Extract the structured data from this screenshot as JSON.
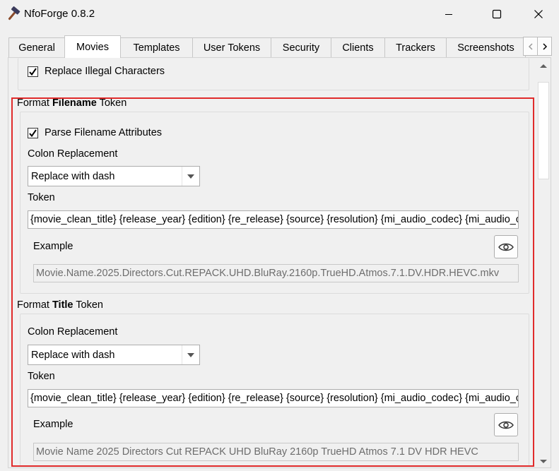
{
  "window": {
    "title": "NfoForge 0.8.2",
    "icons": {
      "app": "hammer-icon",
      "minimize": "minimize-icon",
      "maximize": "maximize-icon",
      "close": "close-icon"
    }
  },
  "tabs": [
    "General",
    "Movies",
    "Templates",
    "User Tokens",
    "Security",
    "Clients",
    "Trackers",
    "Screenshots"
  ],
  "active_tab": "Movies",
  "top_section": {
    "replace_illegal_label": "Replace Illegal Characters",
    "replace_illegal_checked": true
  },
  "filename_section": {
    "title_prefix": "Format ",
    "title_bold": "Filename",
    "title_suffix": " Token",
    "parse_label": "Parse Filename Attributes",
    "parse_checked": true,
    "colon_label": "Colon Replacement",
    "colon_value": "Replace with dash",
    "token_label": "Token",
    "token_value": "{movie_clean_title} {release_year} {edition} {re_release} {source} {resolution} {mi_audio_codec} {mi_audio_channel_s}",
    "example_label": "Example",
    "example_value": "Movie.Name.2025.Directors.Cut.REPACK.UHD.BluRay.2160p.TrueHD.Atmos.7.1.DV.HDR.HEVC.mkv"
  },
  "title_section": {
    "title_prefix": "Format ",
    "title_bold": "Title",
    "title_suffix": " Token",
    "colon_label": "Colon Replacement",
    "colon_value": "Replace with dash",
    "token_label": "Token",
    "token_value": "{movie_clean_title} {release_year} {edition} {re_release} {source} {resolution} {mi_audio_codec} {mi_audio_channel_s}",
    "example_label": "Example",
    "example_value": "Movie Name 2025 Directors Cut REPACK UHD BluRay 2160p TrueHD Atmos 7.1 DV HDR HEVC"
  },
  "colors": {
    "highlight_border": "#e02b2b",
    "window_bg": "#f0f0f0"
  }
}
